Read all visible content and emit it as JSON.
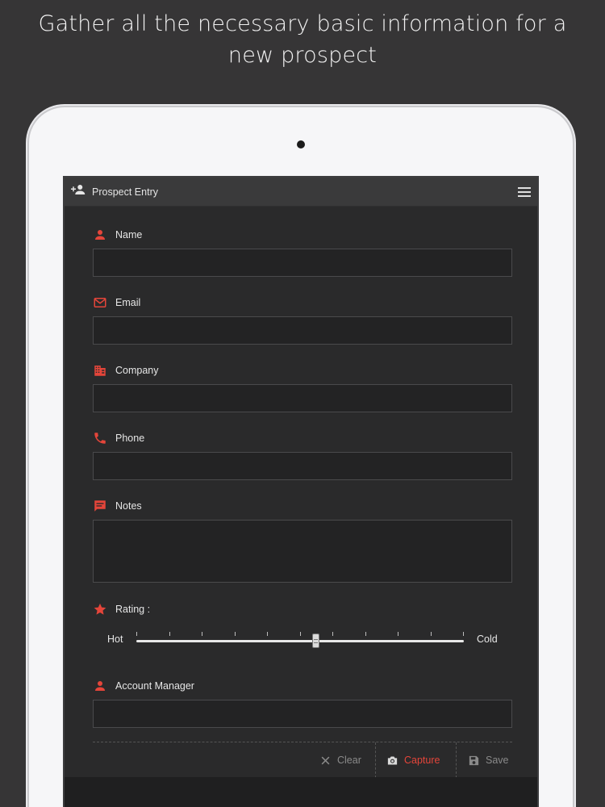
{
  "headline": "Gather all the necessary basic information for a new prospect",
  "appbar": {
    "title": "Prospect Entry"
  },
  "fields": {
    "name": {
      "label": "Name",
      "value": ""
    },
    "email": {
      "label": "Email",
      "value": ""
    },
    "company": {
      "label": "Company",
      "value": ""
    },
    "phone": {
      "label": "Phone",
      "value": ""
    },
    "notes": {
      "label": "Notes",
      "value": ""
    },
    "account_manager": {
      "label": "Account Manager",
      "value": ""
    }
  },
  "rating": {
    "label": "Rating :",
    "min_label": "Hot",
    "max_label": "Cold",
    "ticks": 10,
    "value": 0.55
  },
  "actions": {
    "clear": "Clear",
    "capture": "Capture",
    "save": "Save"
  },
  "colors": {
    "accent": "#e4453a",
    "background": "#363536",
    "screen": "#2a2a2b",
    "appbar": "#3a3a3b"
  },
  "icons": {
    "appbar": "add-user-icon",
    "menu": "hamburger-menu-icon",
    "name": "person-icon",
    "email": "envelope-icon",
    "company": "building-icon",
    "phone": "phone-icon",
    "notes": "message-icon",
    "rating": "star-icon",
    "account_manager": "person-icon",
    "clear": "close-icon",
    "capture": "camera-icon",
    "save": "floppy-disk-icon"
  }
}
